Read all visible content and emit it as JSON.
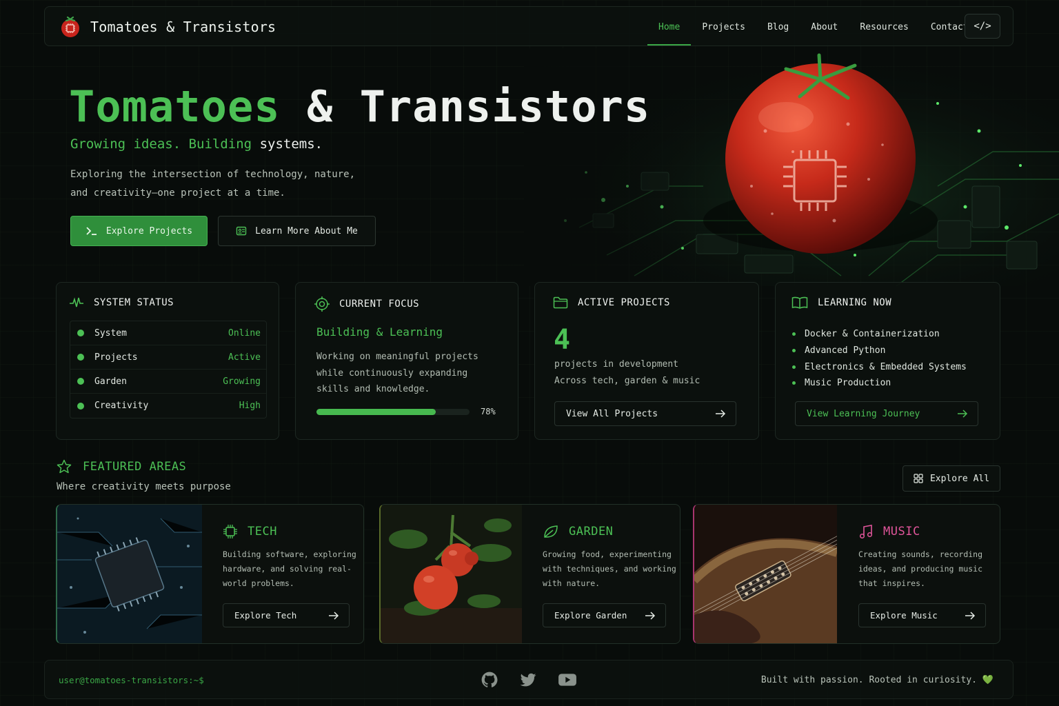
{
  "brand": {
    "title": "Tomatoes & Transistors",
    "logo_icon": "tomato-chip-icon"
  },
  "nav": {
    "items": [
      {
        "label": "Home",
        "active": true
      },
      {
        "label": "Projects"
      },
      {
        "label": "Blog"
      },
      {
        "label": "About"
      },
      {
        "label": "Resources"
      },
      {
        "label": "Contact"
      }
    ],
    "code_button": "</>"
  },
  "hero": {
    "title_part1": "Tomatoes",
    "title_part2": "& Transistors",
    "subtitle_green": "Growing ideas. Building",
    "subtitle_white": "systems.",
    "desc_line1": "Exploring the intersection of technology, nature,",
    "desc_line2": "and creativity—one project at a time.",
    "primary_button": "Explore Projects",
    "secondary_button": "Learn More About Me"
  },
  "system_status": {
    "title": "SYSTEM STATUS",
    "rows": [
      {
        "label": "System",
        "value": "Online"
      },
      {
        "label": "Projects",
        "value": "Active"
      },
      {
        "label": "Garden",
        "value": "Growing"
      },
      {
        "label": "Creativity",
        "value": "High"
      }
    ]
  },
  "current_focus": {
    "title": "CURRENT FOCUS",
    "heading": "Building & Learning",
    "desc_line1": "Working on meaningful projects",
    "desc_line2": "while continuously expanding",
    "desc_line3": "skills and knowledge.",
    "progress_percent": 78,
    "progress_label": "78%"
  },
  "active_projects": {
    "title": "ACTIVE PROJECTS",
    "count": "4",
    "line1": "projects in development",
    "line2": "Across tech, garden & music",
    "button": "View All Projects"
  },
  "learning_now": {
    "title": "LEARNING NOW",
    "items": [
      "Docker & Containerization",
      "Advanced Python",
      "Electronics & Embedded Systems",
      "Music Production"
    ],
    "button": "View Learning Journey"
  },
  "featured": {
    "title": "FEATURED AREAS",
    "subtitle": "Where creativity meets purpose",
    "explore_all": "Explore All",
    "areas": [
      {
        "title": "TECH",
        "desc": [
          "Building software, exploring",
          "hardware, and solving real-",
          "world problems."
        ],
        "button": "Explore Tech",
        "color": "#4cc055"
      },
      {
        "title": "GARDEN",
        "desc": [
          "Growing food, experimenting",
          "with techniques, and working",
          "with nature."
        ],
        "button": "Explore Garden",
        "color": "#4cc055"
      },
      {
        "title": "MUSIC",
        "desc": [
          "Creating sounds, recording",
          "ideas, and producing music",
          "that inspires."
        ],
        "button": "Explore Music",
        "color": "#e0559a"
      }
    ]
  },
  "footer": {
    "prompt": "user@tomatoes-transistors:~$",
    "socials": [
      "github-icon",
      "twitter-icon",
      "youtube-icon"
    ],
    "tagline": "Built with passion. Rooted in curiosity. 💚"
  },
  "colors": {
    "accent": "#4cc055",
    "background": "#080c0a",
    "music_accent": "#e0559a"
  }
}
